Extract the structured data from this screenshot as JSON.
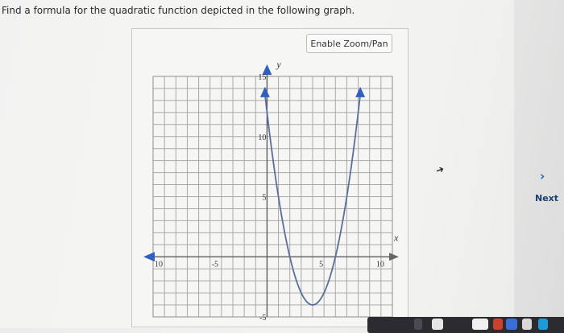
{
  "question": {
    "text": "Find a formula for the quadratic function depicted in the following graph."
  },
  "toolbar": {
    "zoom_label": "Enable Zoom/Pan"
  },
  "navigation": {
    "next_label": "Next",
    "next_icon": "chevron-right-icon"
  },
  "chart_data": {
    "type": "line",
    "title": "",
    "xlabel": "x",
    "ylabel": "y",
    "xlim": [
      -10,
      11
    ],
    "ylim": [
      -5,
      15
    ],
    "grid": true,
    "x_ticks": [
      {
        "value": -10,
        "label": "10"
      },
      {
        "value": -5,
        "label": "-5"
      },
      {
        "value": 5,
        "label": "5"
      },
      {
        "value": 10,
        "label": "10"
      }
    ],
    "y_ticks": [
      {
        "value": 15,
        "label": "15"
      },
      {
        "value": 10,
        "label": "10"
      },
      {
        "value": 5,
        "label": "5"
      },
      {
        "value": -5,
        "label": "-5"
      }
    ],
    "series": [
      {
        "vertex": [
          4,
          -4
        ],
        "points": [
          [
            0,
            12
          ],
          [
            1,
            5
          ],
          [
            2,
            0
          ],
          [
            3,
            -3
          ],
          [
            4,
            -4
          ],
          [
            5,
            -3
          ],
          [
            6,
            0
          ],
          [
            7,
            5
          ],
          [
            8,
            12
          ]
        ],
        "color": "#5a6f9c"
      }
    ],
    "axis_color": "#2f5fbf"
  }
}
